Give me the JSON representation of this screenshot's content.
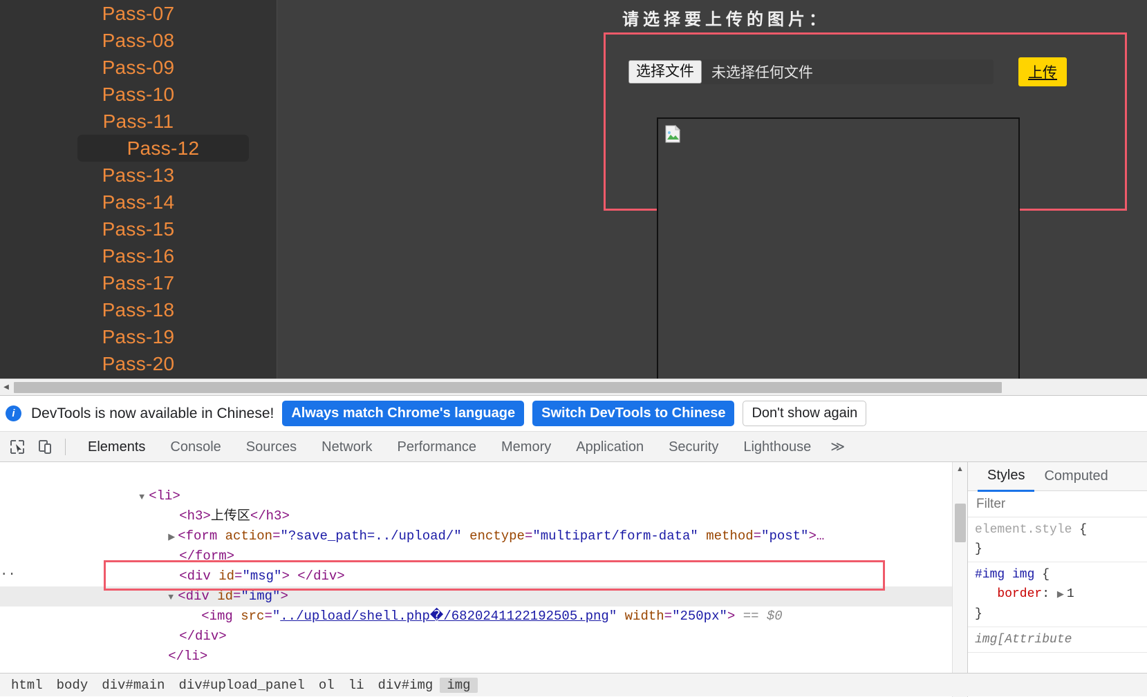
{
  "page": {
    "nav_items": [
      {
        "label": "Pass-07",
        "active": false
      },
      {
        "label": "Pass-08",
        "active": false
      },
      {
        "label": "Pass-09",
        "active": false
      },
      {
        "label": "Pass-10",
        "active": false
      },
      {
        "label": "Pass-11",
        "active": false
      },
      {
        "label": "Pass-12",
        "active": true
      },
      {
        "label": "Pass-13",
        "active": false
      },
      {
        "label": "Pass-14",
        "active": false
      },
      {
        "label": "Pass-15",
        "active": false
      },
      {
        "label": "Pass-16",
        "active": false
      },
      {
        "label": "Pass-17",
        "active": false
      },
      {
        "label": "Pass-18",
        "active": false
      },
      {
        "label": "Pass-19",
        "active": false
      },
      {
        "label": "Pass-20",
        "active": false
      }
    ],
    "nav_accent_color": "#ef8a3c",
    "upload": {
      "heading": "请选择要上传的图片：",
      "choose_file_label": "选择文件",
      "file_status": "未选择任何文件",
      "submit_label": "上传",
      "submit_color": "#ffd400",
      "highlight_color": "#ef5a6a"
    }
  },
  "devtools": {
    "banner": {
      "info_icon": "info-icon",
      "message": "DevTools is now available in Chinese!",
      "btn_always_match": "Always match Chrome's language",
      "btn_switch": "Switch DevTools to Chinese",
      "btn_dismiss": "Don't show again",
      "primary_color": "#1a73e8"
    },
    "tabs": [
      {
        "label": "Elements",
        "active": true
      },
      {
        "label": "Console",
        "active": false
      },
      {
        "label": "Sources",
        "active": false
      },
      {
        "label": "Network",
        "active": false
      },
      {
        "label": "Performance",
        "active": false
      },
      {
        "label": "Memory",
        "active": false
      },
      {
        "label": "Application",
        "active": false
      },
      {
        "label": "Security",
        "active": false
      },
      {
        "label": "Lighthouse",
        "active": false
      }
    ],
    "tab_overflow": "≫",
    "dom": {
      "line1_tag": "<li>",
      "line2": "<h3>上传区</h3>",
      "line2_open": "<h3>",
      "line2_text": "上传区",
      "line2_close": "</h3>",
      "line3_open": "<form ",
      "line3_attr1": "action",
      "line3_val1": "\"?save_path=../upload/\"",
      "line3_attr2": "enctype",
      "line3_val2": "\"multipart/form-data\"",
      "line3_attr3": "method",
      "line3_val3": "\"post\"",
      "line3_close": ">…",
      "line4": "</form>",
      "line5_open": "<div ",
      "line5_attr": "id",
      "line5_val": "\"msg\"",
      "line5_mid": "> </div>",
      "line6_open": "<div ",
      "line6_attr": "id",
      "line6_val": "\"img\"",
      "line6_close": ">",
      "line7_open": "<img ",
      "line7_attr1": "src",
      "line7_val1_prefix": "\"",
      "line7_link": "../upload/shell.php�/6820241122192505.png",
      "line7_val1_suffix": "\"",
      "line7_attr2": "width",
      "line7_val2": "\"250px\"",
      "line7_close": ">",
      "line7_marker": "== $0",
      "line8": "</div>",
      "line9": "</li>",
      "ellipsis_marker": "··"
    },
    "styles": {
      "tab_styles": "Styles",
      "tab_computed": "Computed",
      "filter_placeholder": "Filter",
      "rule1_selector": "element.style",
      "rule1_open": " {",
      "rule1_close": "}",
      "rule2_selector": "#img img",
      "rule2_open": " {",
      "rule2_prop": "border",
      "rule2_value": "1",
      "rule2_close": "}",
      "rule3_selector": "img[Attribute"
    },
    "breadcrumb": [
      {
        "label": "html",
        "active": false
      },
      {
        "label": "body",
        "active": false
      },
      {
        "label": "div#main",
        "active": false
      },
      {
        "label": "div#upload_panel",
        "active": false
      },
      {
        "label": "ol",
        "active": false
      },
      {
        "label": "li",
        "active": false
      },
      {
        "label": "div#img",
        "active": false
      },
      {
        "label": "img",
        "active": true
      }
    ]
  }
}
